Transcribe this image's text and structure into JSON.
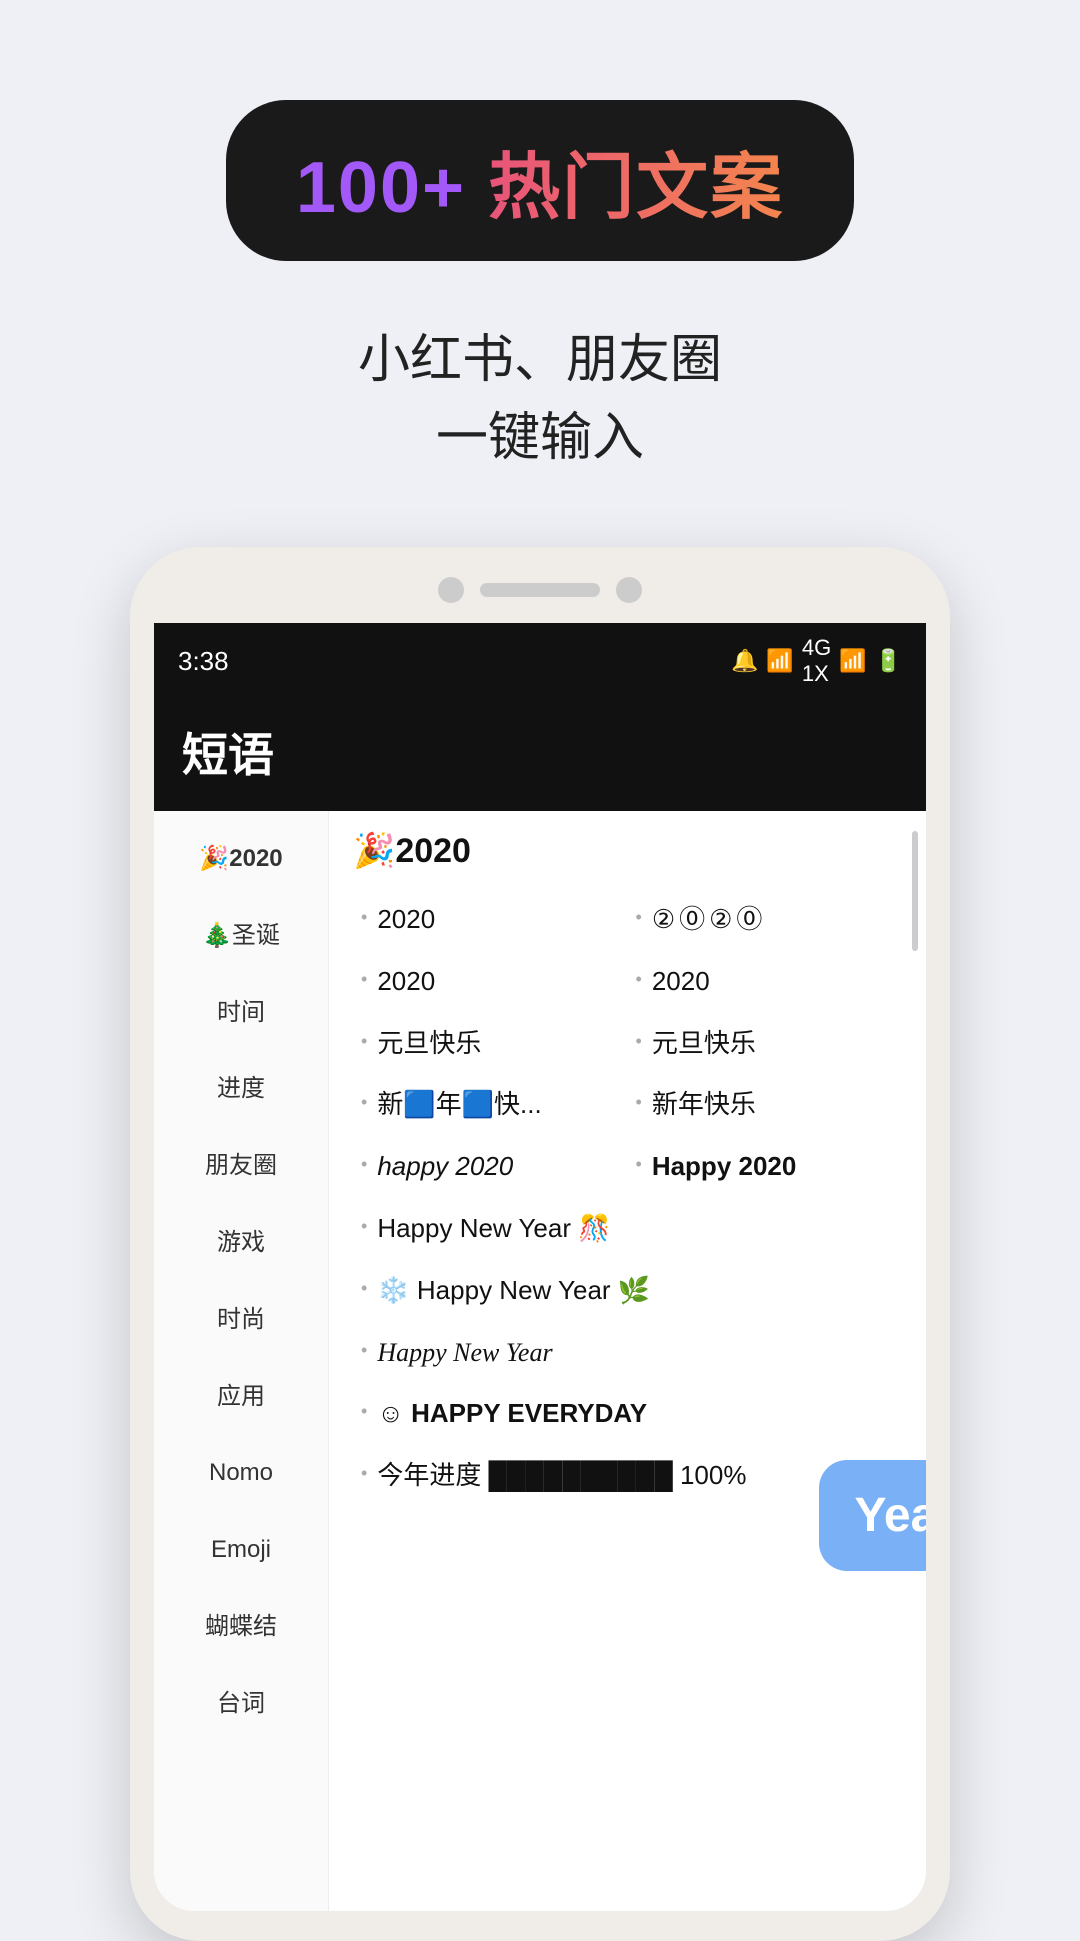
{
  "header": {
    "badge": {
      "num": "100+",
      "cn": "热门文案"
    },
    "subtitle_line1": "小红书、朋友圈",
    "subtitle_line2": "一键输入"
  },
  "status_bar": {
    "time": "3:38",
    "icons": "🔔 📶 4G 📶 🔋"
  },
  "app": {
    "title": "短语"
  },
  "sidebar": {
    "items": [
      {
        "label": "🎉2020",
        "active": true
      },
      {
        "label": "🎄圣诞"
      },
      {
        "label": "时间"
      },
      {
        "label": "进度"
      },
      {
        "label": "朋友圈"
      },
      {
        "label": "游戏"
      },
      {
        "label": "时尚"
      },
      {
        "label": "应用"
      },
      {
        "label": "Nomo"
      },
      {
        "label": "Emoji"
      },
      {
        "label": "蝴蝶结"
      },
      {
        "label": "台词"
      }
    ]
  },
  "main": {
    "section_title": "🎉2020",
    "items": [
      {
        "text": "2020",
        "style": "normal",
        "col": 1
      },
      {
        "text": "②⓪②⓪",
        "style": "circled",
        "col": 2
      },
      {
        "text": "2020",
        "style": "normal",
        "col": 1
      },
      {
        "text": "2020",
        "style": "normal",
        "col": 2
      },
      {
        "text": "元旦快乐",
        "style": "normal",
        "col": 1
      },
      {
        "text": "元旦快乐",
        "style": "normal",
        "col": 2
      },
      {
        "text": "新🟦年🟦快...",
        "style": "normal",
        "col": 1
      },
      {
        "text": "新年快乐",
        "style": "normal",
        "col": 2
      },
      {
        "text": "happy 2020",
        "style": "italic",
        "col": 1
      },
      {
        "text": "Happy 2020",
        "style": "bold",
        "col": 2
      },
      {
        "text": "Happy New Year 🎊",
        "style": "normal",
        "col": "full"
      },
      {
        "text": "❄️ Happy New Year 🌿",
        "style": "normal",
        "col": "full"
      },
      {
        "text": "Happy New Year",
        "style": "cursive",
        "col": "full"
      },
      {
        "text": "☺ HAPPY EVERYDAY",
        "style": "caps",
        "col": "full"
      },
      {
        "text": "今年进度 ██████████ 100%",
        "style": "normal",
        "col": "full"
      }
    ]
  },
  "popup": {
    "text": "Year Pr"
  }
}
